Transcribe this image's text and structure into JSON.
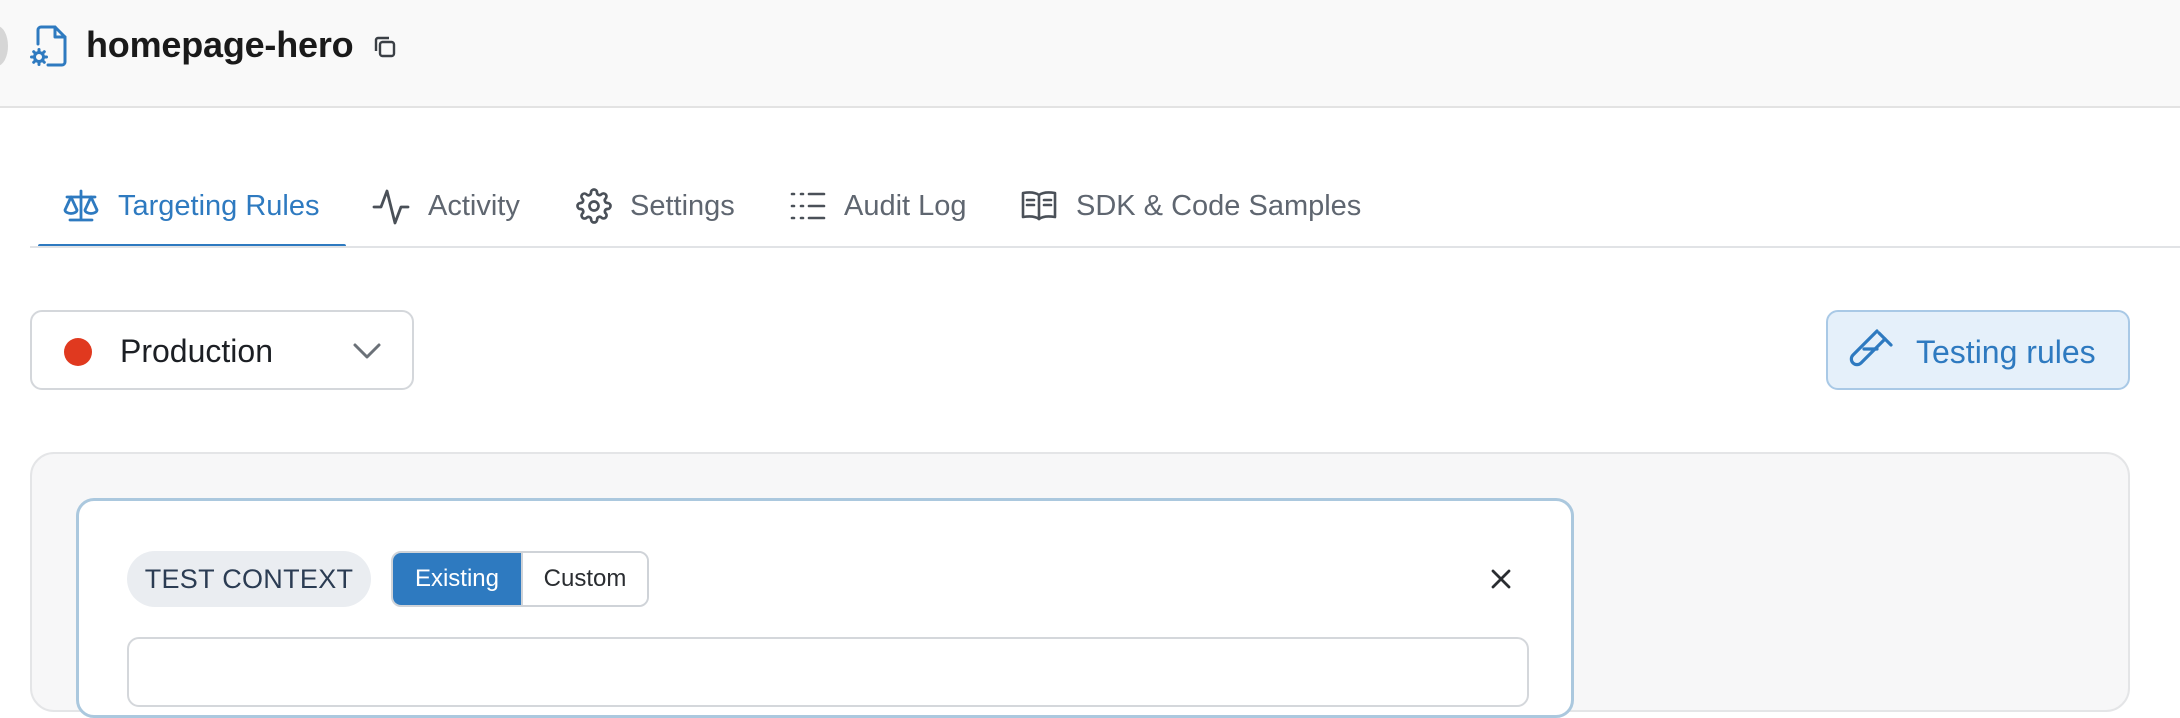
{
  "header": {
    "flag_name": "homepage-hero",
    "icons": {
      "file": "file-gear-icon",
      "copy": "copy-icon"
    }
  },
  "tabs": [
    {
      "label": "Targeting Rules",
      "icon": "scale-icon",
      "active": true
    },
    {
      "label": "Activity",
      "icon": "activity-icon",
      "active": false
    },
    {
      "label": "Settings",
      "icon": "gear-icon",
      "active": false
    },
    {
      "label": "Audit Log",
      "icon": "list-icon",
      "active": false
    },
    {
      "label": "SDK & Code Samples",
      "icon": "book-icon",
      "active": false
    }
  ],
  "environment": {
    "selected": "Production",
    "status_color": "#e0391f",
    "icon": "chevron-down-icon"
  },
  "testing_button": {
    "label": "Testing rules",
    "icon": "test-tube-icon",
    "color": "#2e7ac0"
  },
  "test_context": {
    "badge": "TEST CONTEXT",
    "segments": [
      "Existing",
      "Custom"
    ],
    "selected_segment": "Existing",
    "close_icon": "close-icon"
  },
  "colors": {
    "accent": "#2e7ac0",
    "production": "#e0391f"
  }
}
